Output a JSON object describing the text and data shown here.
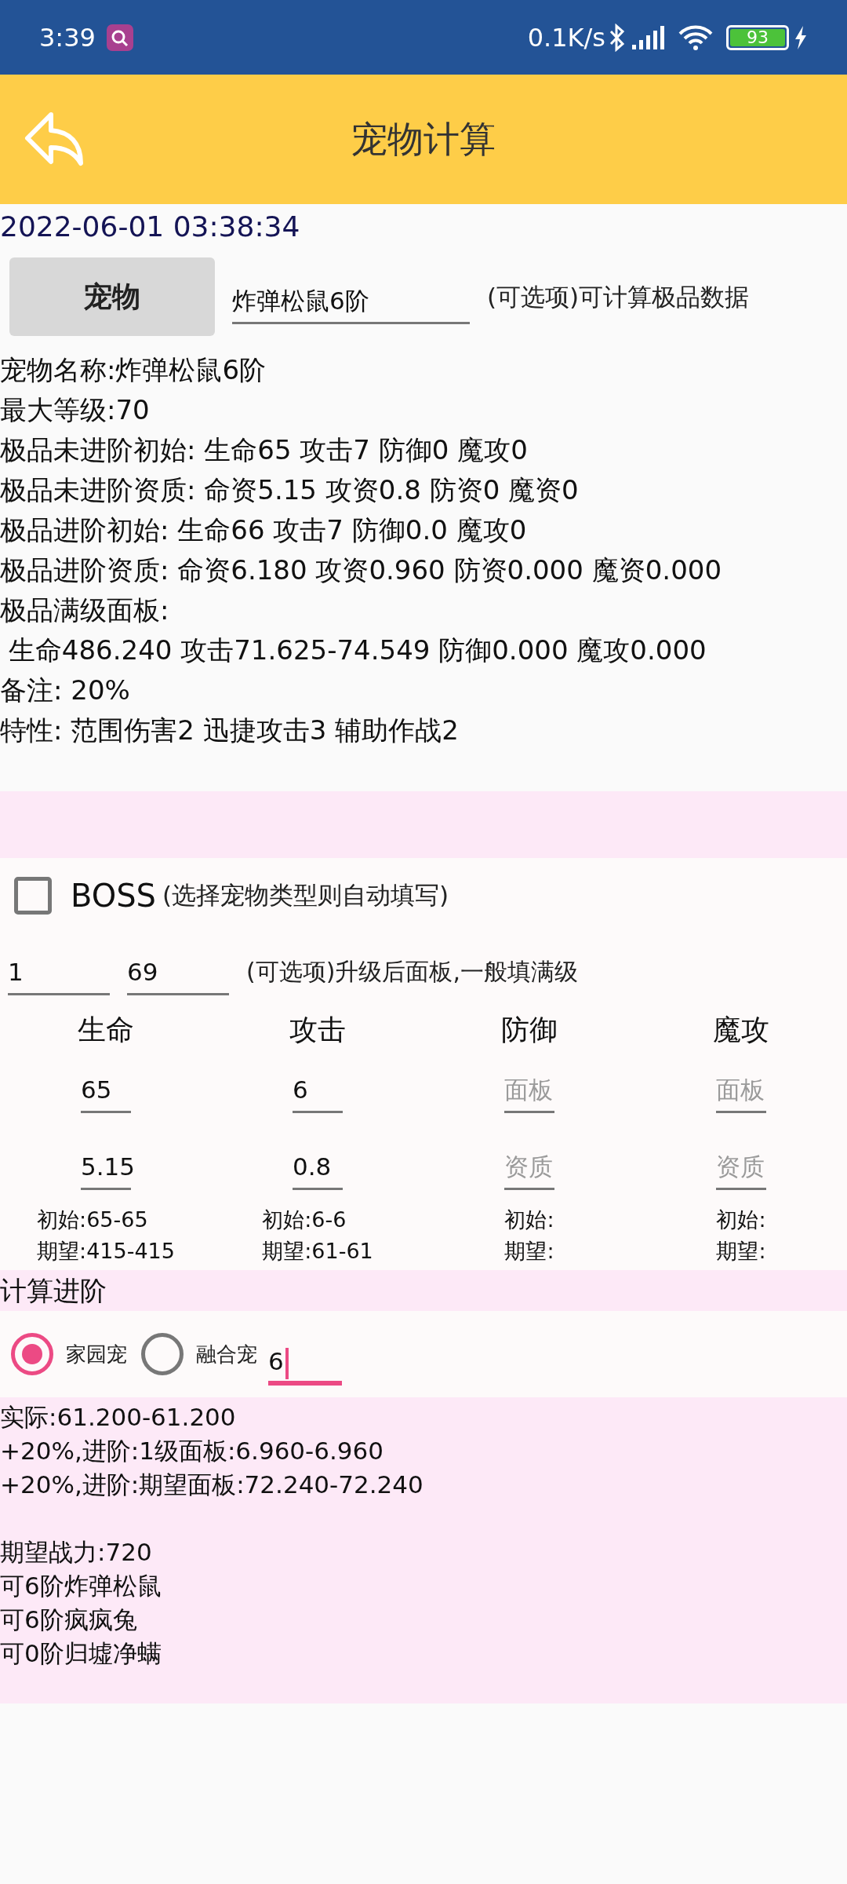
{
  "status_bar": {
    "time": "3:39",
    "network_speed": "0.1K/s",
    "battery": "93"
  },
  "header": {
    "title": "宠物计算"
  },
  "timestamp": "2022-06-01 03:38:34",
  "pet_selector": {
    "button": "宠物",
    "value": "炸弹松鼠6阶",
    "hint": "(可选项)可计算极品数据"
  },
  "info_lines": [
    "宠物名称:炸弹松鼠6阶",
    "最大等级:70",
    "极品未进阶初始: 生命65 攻击7 防御0 魔攻0",
    "极品未进阶资质: 命资5.15 攻资0.8 防资0 魔资0",
    "极品进阶初始: 生命66 攻击7 防御0.0 魔攻0",
    "极品进阶资质: 命资6.180 攻资0.960 防资0.000 魔资0.000",
    "极品满级面板:",
    " 生命486.240 攻击71.625-74.549 防御0.000 魔攻0.000",
    "备注: 20%",
    "特性: 范围伤害2 迅捷攻击3 辅助作战2"
  ],
  "boss": {
    "label": "BOSS",
    "hint": "(选择宠物类型则自动填写)",
    "checked": false
  },
  "levels": {
    "from": "1",
    "to": "69",
    "hint": "(可选项)升级后面板,一般填满级"
  },
  "stats": [
    {
      "name": "生命",
      "panel": {
        "value": "65"
      },
      "aptitude": {
        "value": "5.15"
      },
      "initial": "初始:65-65",
      "expected": "期望:415-415"
    },
    {
      "name": "攻击",
      "panel": {
        "value": "6"
      },
      "aptitude": {
        "value": "0.8"
      },
      "initial": "初始:6-6",
      "expected": "期望:61-61"
    },
    {
      "name": "防御",
      "panel": {
        "placeholder": "面板"
      },
      "aptitude": {
        "placeholder": "资质"
      },
      "initial": "初始:",
      "expected": "期望:"
    },
    {
      "name": "魔攻",
      "panel": {
        "placeholder": "面板"
      },
      "aptitude": {
        "placeholder": "资质"
      },
      "initial": "初始:",
      "expected": "期望:"
    }
  ],
  "advance": {
    "title": "计算进阶",
    "options": [
      {
        "label": "家园宠",
        "selected": true
      },
      {
        "label": "融合宠",
        "selected": false
      }
    ],
    "field": {
      "value": "6",
      "focused": true
    }
  },
  "results": [
    [
      "实际:61.200-61.200",
      "+20%,进阶:1级面板:6.960-6.960",
      "+20%,进阶:期望面板:72.240-72.240"
    ],
    [
      "期望战力:720",
      "可6阶炸弹松鼠",
      "可6阶疯疯兔",
      "可0阶归墟净螨"
    ]
  ]
}
